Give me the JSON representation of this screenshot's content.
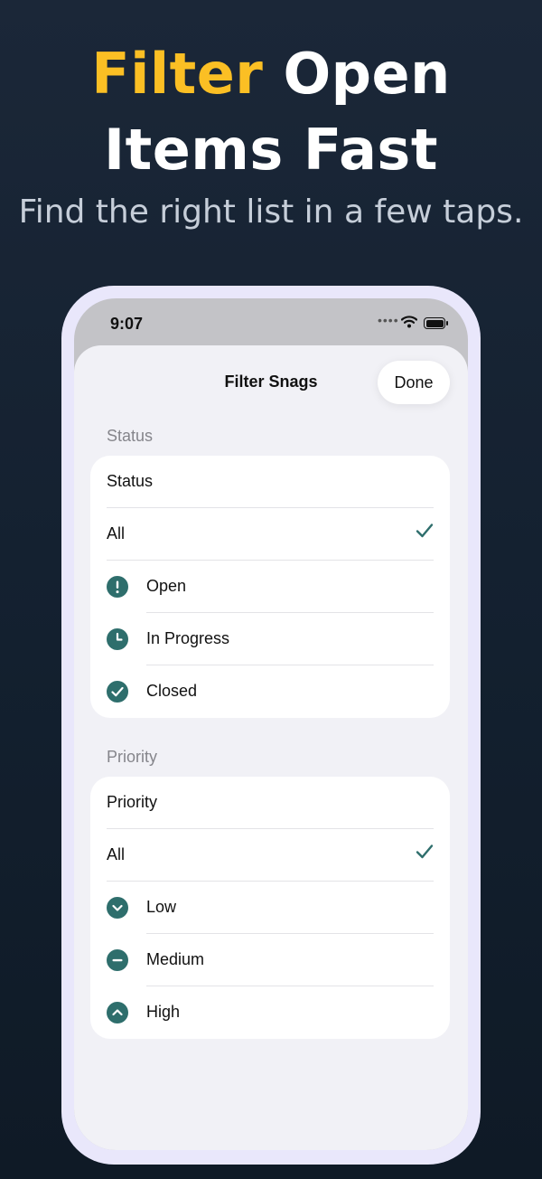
{
  "promo": {
    "headline_accent": "Filter",
    "headline_line1_rest": " Open",
    "headline_line2": "Items Fast",
    "subheadline": "Find the right list in a few taps."
  },
  "status_bar": {
    "time": "9:07"
  },
  "sheet": {
    "title": "Filter Snags",
    "done_label": "Done"
  },
  "status_section": {
    "header": "Status",
    "title": "Status",
    "options": [
      {
        "label": "All",
        "icon": "none",
        "selected": true
      },
      {
        "label": "Open",
        "icon": "exclamation-circle-icon",
        "selected": false
      },
      {
        "label": "In Progress",
        "icon": "clock-icon",
        "selected": false
      },
      {
        "label": "Closed",
        "icon": "checkmark-circle-icon",
        "selected": false
      }
    ]
  },
  "priority_section": {
    "header": "Priority",
    "title": "Priority",
    "options": [
      {
        "label": "All",
        "icon": "none",
        "selected": true
      },
      {
        "label": "Low",
        "icon": "chevron-down-circle-icon",
        "selected": false
      },
      {
        "label": "Medium",
        "icon": "minus-circle-icon",
        "selected": false
      },
      {
        "label": "High",
        "icon": "chevron-up-circle-icon",
        "selected": false
      }
    ]
  },
  "colors": {
    "accent": "#fbbf24",
    "icon_teal": "#2e6e6c",
    "check_teal": "#2e6e6c",
    "background": "#16222f",
    "phone_frame": "#e9e7fb"
  }
}
